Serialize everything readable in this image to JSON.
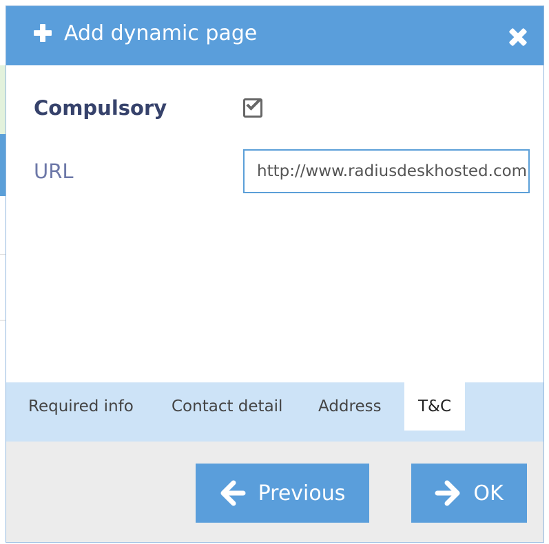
{
  "dialog": {
    "title": "Add dynamic page",
    "title_icon": "plus-icon",
    "close_icon": "close-icon"
  },
  "form": {
    "compulsory_label": "Compulsory",
    "compulsory_checked": true,
    "url_label": "URL",
    "url_value": "http://www.radiusdeskhosted.com"
  },
  "tabs": [
    {
      "label": "Required info",
      "active": false
    },
    {
      "label": "Contact detail",
      "active": false
    },
    {
      "label": "Address",
      "active": false
    },
    {
      "label": "T&C",
      "active": true
    }
  ],
  "buttons": {
    "previous_label": "Previous",
    "previous_icon": "arrow-left-icon",
    "ok_label": "OK",
    "ok_icon": "arrow-right-icon"
  },
  "colors": {
    "accent": "#5a9edb",
    "tabbar": "#cde3f7",
    "label_dark": "#36426b",
    "label_muted": "#6d78a8"
  }
}
